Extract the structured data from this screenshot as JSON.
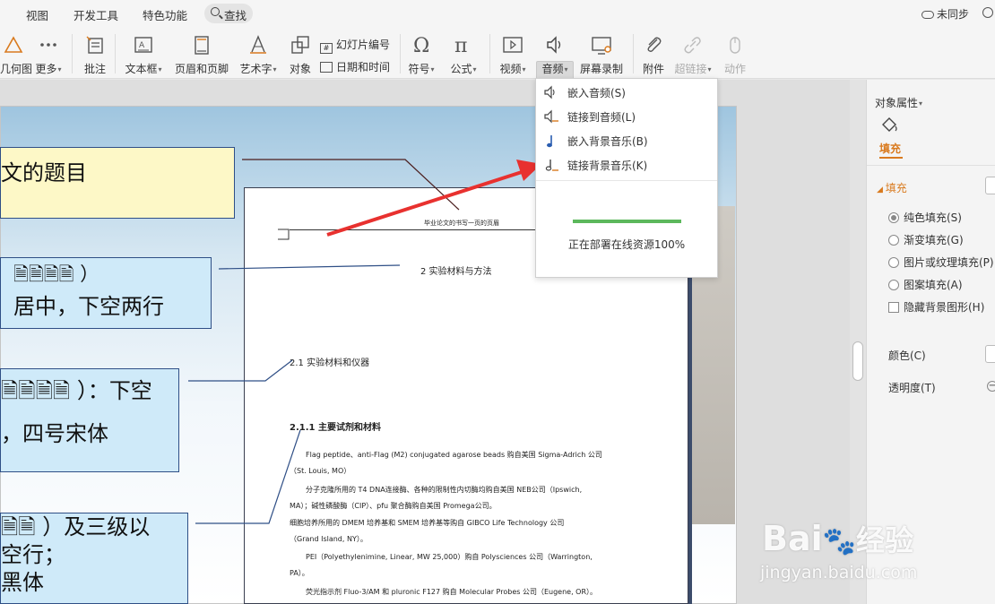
{
  "menu": {
    "view": "视图",
    "dev_tools": "开发工具",
    "special": "特色功能",
    "search": "查找",
    "sync_status": "未同步"
  },
  "ribbon": {
    "geometry": "几何图",
    "more": "更多",
    "comment": "批注",
    "textbox": "文本框",
    "header_footer": "页眉和页脚",
    "wordart": "艺术字",
    "object": "对象",
    "slide_number": "幻灯片编号",
    "date_time": "日期和时间",
    "symbol": "符号",
    "formula": "公式",
    "video": "视频",
    "audio": "音频",
    "screen_record": "屏幕录制",
    "attachment": "附件",
    "hyperlink": "超链接",
    "action": "动作"
  },
  "audio_menu": {
    "items": [
      {
        "label": "嵌入音频(S)",
        "icon": "speaker-icon"
      },
      {
        "label": "链接到音频(L)",
        "icon": "speaker-link-icon"
      },
      {
        "label": "嵌入背景音乐(B)",
        "icon": "music-note-icon"
      },
      {
        "label": "链接背景音乐(K)",
        "icon": "music-link-icon"
      }
    ],
    "progress": 1.0,
    "status": "正在部署在线资源100%"
  },
  "slide": {
    "callout1": "文的题目",
    "callout2_line1": "🗎🗎🗎🗎 ）",
    "callout2_line2": "居中，下空两行",
    "callout3_line1": "🗎🗎🗎🗎 ）：下空",
    "callout3_line2": "，四号宋体",
    "callout4_line1": "🗎🗎 ）及三级以",
    "callout4_line2": "空行；",
    "callout4_line3": "黑体"
  },
  "document": {
    "running_header": "毕业论文的书写一页的页眉",
    "chapter": "2  实验材料与方法",
    "section": "2.1  实验材料和仪器",
    "subsection": "2.1.1 主要试剂和材料",
    "para1": "Flag peptide、anti-Flag (M2) conjugated agarose beads 购自美国 Sigma-Adrich 公司",
    "para1b": "（St. Louis, MO）",
    "para2": "分子克隆所用的 T4 DNA连接酶、各种的限制性内切酶均购自美国 NEB公司（Ipswich,",
    "para2b": "MA）；碱性磷酸酶（CIP）、pfu 聚合酶购自美国 Promega公司。",
    "para3": "细胞培养所用的 DMEM 培养基和 SMEM 培养基等购自 GIBCO Life Technology 公司",
    "para3b": "（Grand Island, NY）。",
    "para4": "PEI（Polyethylenimine, Linear, MW 25,000）购自 Polysciences 公司（Warrington,",
    "para4b": "PA）。",
    "para5": "荧光指示剂 Fluo-3/AM 和 pluronic F127 购自 Molecular Probes 公司（Eugene, OR）。"
  },
  "panel": {
    "title": "对象属性",
    "tab": "填充",
    "section": "填充",
    "options": [
      "纯色填充(S)",
      "渐变填充(G)",
      "图片或纹理填充(P)",
      "图案填充(A)"
    ],
    "hide_bg": "隐藏背景图形(H)",
    "color": "颜色(C)",
    "transparency": "透明度(T)"
  },
  "watermark": {
    "brand": "Bai",
    "brand2": "经验",
    "url": "jingyan.baidu.com"
  },
  "colors": {
    "accent_orange": "#d97a1e",
    "arrow_red": "#e8312f",
    "progress_green": "#5cb85c"
  }
}
